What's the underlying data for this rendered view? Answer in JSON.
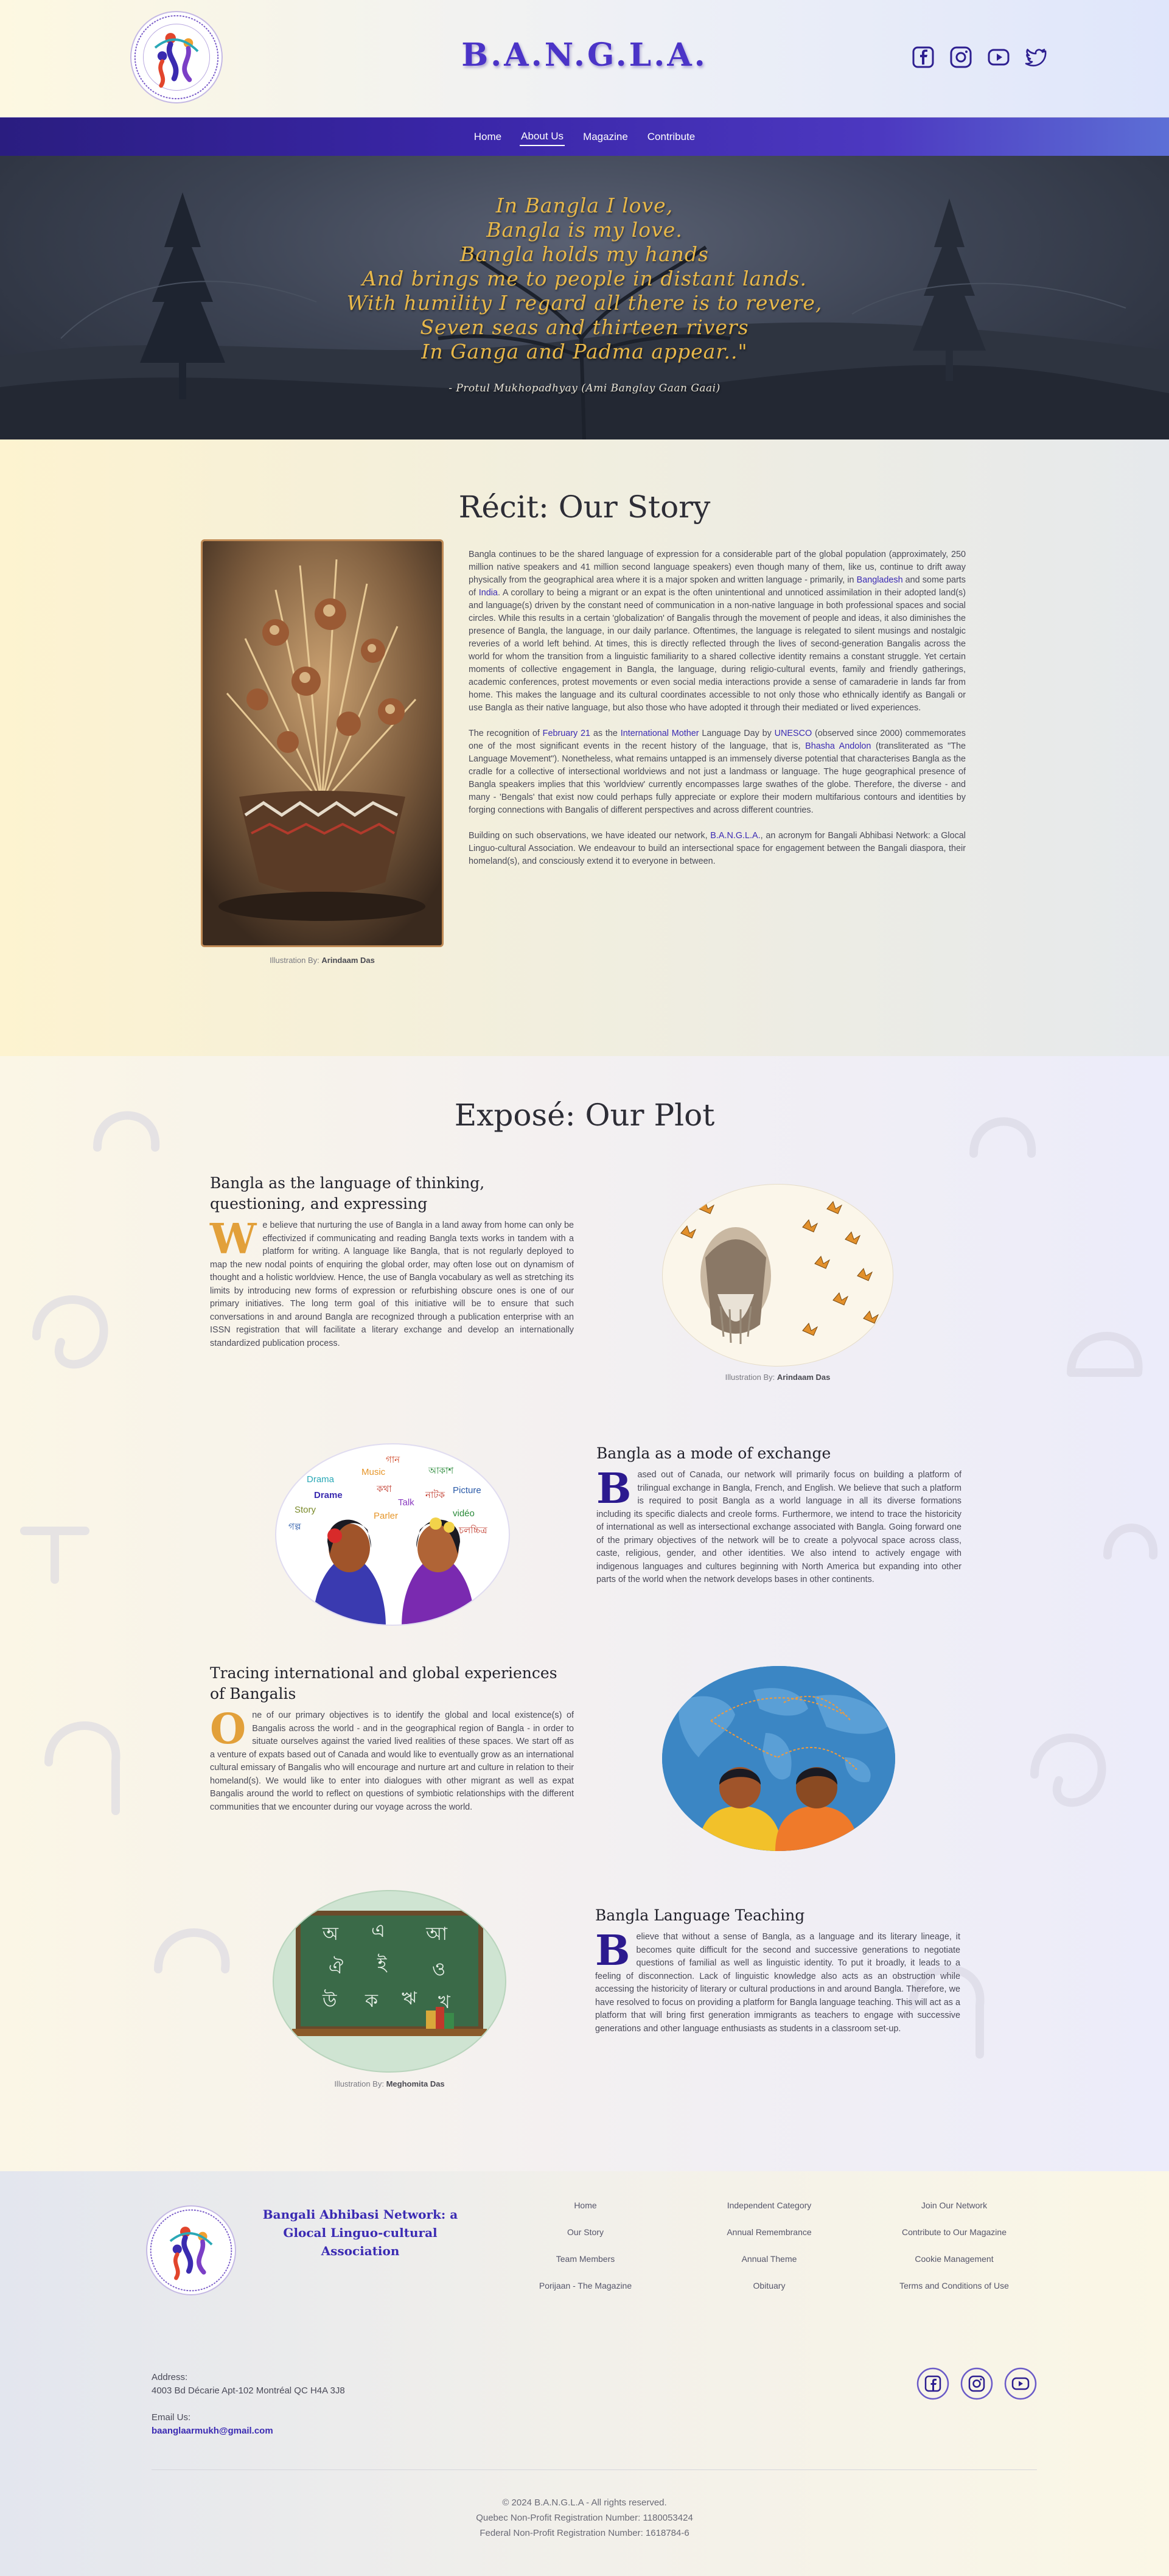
{
  "header": {
    "title": "B.A.N.G.L.A.",
    "social_icons": [
      "facebook-icon",
      "instagram-icon",
      "youtube-icon",
      "twitter-icon"
    ]
  },
  "nav": {
    "items": [
      {
        "label": "Home"
      },
      {
        "label": "About Us",
        "active": true
      },
      {
        "label": "Magazine"
      },
      {
        "label": "Contribute"
      }
    ]
  },
  "hero": {
    "poem": [
      "In Bangla I love,",
      "Bangla is my love.",
      "Bangla holds my hands",
      "And brings me to people in distant lands.",
      "With humility I regard all there is to revere,",
      "Seven seas and thirteen rivers",
      "In Ganga and Padma appear..\""
    ],
    "credit": "- Protul Mukhopadhyay (Ami Banglay Gaan Gaai)"
  },
  "story": {
    "title": "Récit: Our Story",
    "caption_prefix": "Illustration By:",
    "caption_artist": "Arindaam Das",
    "p1_a": "Bangla continues to be the shared language of expression for a considerable part of the global population (approximately, 250 million native speakers and 41 million second language speakers) even though many of them, like us, continue to drift away physically from the geographical area where it is a major spoken and written language - primarily, in ",
    "p1_link1": "Bangladesh",
    "p1_b": " and some parts of ",
    "p1_link2": "India",
    "p1_c": ". A corollary to being a migrant or an expat is the often unintentional and unnoticed assimilation in their adopted land(s) and language(s) driven by the constant need of communication in a non-native language in both professional spaces and social circles. While this results in a certain 'globalization' of Bangalis through the movement of people and ideas, it also diminishes the presence of Bangla, the language, in our daily parlance. Oftentimes, the language is relegated to silent musings and nostalgic reveries of a world left behind. At times, this is directly reflected through the lives of second-generation Bangalis across the world for whom the transition from a linguistic familiarity to a shared collective identity remains a constant struggle. Yet certain moments of collective engagement in Bangla, the language, during religio-cultural events, family and friendly gatherings, academic conferences, protest movements or even social media interactions provide a sense of camaraderie in lands far from home. This makes the language and its cultural coordinates accessible to not only those who ethnically identify as Bangali or use Bangla as their native language, but also those who have adopted it through their mediated or lived experiences.",
    "p2_a": "The recognition of ",
    "p2_link1": "February 21",
    "p2_b": " as the ",
    "p2_link2": "International Mother",
    "p2_c": " Language Day by ",
    "p2_link3": "UNESCO",
    "p2_d": " (observed since 2000) commemorates one of the most significant events in the recent history of the language, that is, ",
    "p2_link4": "Bhasha Andolon",
    "p2_e": " (transliterated as \"The Language Movement\"). Nonetheless, what remains untapped is an immensely diverse potential that characterises Bangla as the cradle for a collective of intersectional worldviews and not just a landmass or language. The huge geographical presence of Bangla speakers implies that this 'worldview' currently encompasses large swathes of the globe. Therefore, the diverse - and many - 'Bengals' that exist now could perhaps fully appreciate or explore their modern multifarious contours and identities by forging connections with Bangalis of different perspectives and across different countries.",
    "p3_a": "Building on such observations, we have ideated our network, ",
    "p3_link1": "B.A.N.G.L.A.",
    "p3_b": ", an acronym for Bangali Abhibasi Network: a Glocal Linguo-cultural Association. We endeavour to build an intersectional space for engagement between the Bangali diaspora, their homeland(s), and consciously extend it to everyone in between."
  },
  "plot": {
    "title": "Exposé: Our Plot",
    "caption_prefix": "Illustration By:",
    "blocks": [
      {
        "heading": "Bangla as the language of thinking, questioning, and expressing",
        "dropcap": "W",
        "text": "e believe that nurturing the use of Bangla in a land away from home can only be effectivized if communicating and reading Bangla texts works in tandem with a platform for writing. A language like Bangla, that is not regularly deployed to map the new nodal points of enquiring the global order, may often lose out on dynamism of thought and a holistic worldview. Hence, the use of Bangla vocabulary as well as stretching its limits by introducing new forms of expression or refurbishing obscure ones is one of our primary initiatives. The long term goal of this initiative will be to ensure that such conversations in and around Bangla are recognized through a publication enterprise with an ISSN registration that will facilitate a literary exchange and develop an internationally standardized publication process.",
        "caption_artist": "Arindaam Das"
      },
      {
        "heading": "Bangla as a mode of exchange",
        "dropcap": "B",
        "text": "ased out of Canada, our network will primarily focus on building a platform of trilingual exchange in Bangla, French, and English. We believe that such a platform is required to posit Bangla as a world language in all its diverse formations including its specific dialects and creole forms. Furthermore, we intend to trace the historicity of international as well as intersectional exchange associated with Bangla. Going forward one of the primary objectives of the network will be to create a polyvocal space across class, caste, religious, gender, and other identities. We also intend to actively engage with indigenous languages and cultures beginning with North America but expanding into other parts of the world when the network develops bases in other continents.",
        "image_words": [
          "গান",
          "আকাশ",
          "Drama",
          "Music",
          "কথা",
          "নাটক",
          "Picture",
          "Story",
          "Talk",
          "vidéo",
          "Drame",
          "গল্প",
          "Parler",
          "চলচ্চিত্র"
        ]
      },
      {
        "heading": "Tracing international and global experiences of Bangalis",
        "dropcap": "O",
        "text": "ne of our primary objectives is to identify the global and local existence(s) of Bangalis across the world - and in the geographical region of Bangla - in order to situate ourselves against the varied lived realities of these spaces. We start off as a venture of expats based out of Canada and would like to eventually grow as an international cultural emissary of Bangalis who will encourage and nurture art and culture in relation to their homeland(s). We would like to enter into dialogues with other migrant as well as expat Bangalis around the world to reflect on questions of symbiotic relationships with the different communities that we encounter during our voyage across the world."
      },
      {
        "heading": "Bangla Language Teaching",
        "dropcap": "B",
        "text": "elieve that without a sense of Bangla, as a language and its literary lineage, it becomes quite difficult for the second and successive generations to negotiate questions of familial as well as linguistic identity. To put it broadly, it leads to a feeling of disconnection. Lack of linguistic knowledge also acts as an obstruction while accessing the historicity of literary or cultural productions in and around Bangla. Therefore, we have resolved to focus on providing a platform for Bangla language teaching. This will act as a platform that will bring first generation immigrants as teachers to engage with successive generations and other language enthusiasts as students in a classroom set-up.",
        "caption_artist": "Meghomita Das",
        "board_words": [
          "অ",
          "এ",
          "আ",
          "ঐ",
          "ই",
          "ও",
          "উ",
          "ক",
          "ঋ",
          "খ"
        ]
      }
    ]
  },
  "footer": {
    "org_name": "Bangali Abhibasi Network: a Glocal Linguo-cultural Association",
    "links_col1": [
      "Home",
      "Our Story",
      "Team Members",
      "Porijaan - The Magazine"
    ],
    "links_col2": [
      "Independent Category",
      "Annual Remembrance",
      "Annual Theme",
      "Obituary"
    ],
    "links_col3": [
      "Join Our Network",
      "Contribute to Our Magazine",
      "Cookie Management",
      "Terms and Conditions of Use"
    ],
    "address_label": "Address:",
    "address": "4003 Bd Décarie Apt-102 Montréal QC H4A 3J8",
    "email_label": "Email Us:",
    "email": "baanglaarmukh@gmail.com",
    "social_icons": [
      "facebook-icon",
      "instagram-icon",
      "youtube-icon"
    ],
    "copyright": "© 2024 B.A.N.G.L.A - All rights reserved.",
    "quebec_reg": "Quebec Non-Profit Registration Number: 1180053424",
    "federal_reg": "Federal Non-Profit Registration Number: 1618784-6"
  },
  "colors": {
    "brand_purple": "#3b2bb3",
    "nav_gradient_start": "#2a1d80",
    "poem_gold": "#e8b84a",
    "dropcap_gold": "#e2a03a"
  }
}
